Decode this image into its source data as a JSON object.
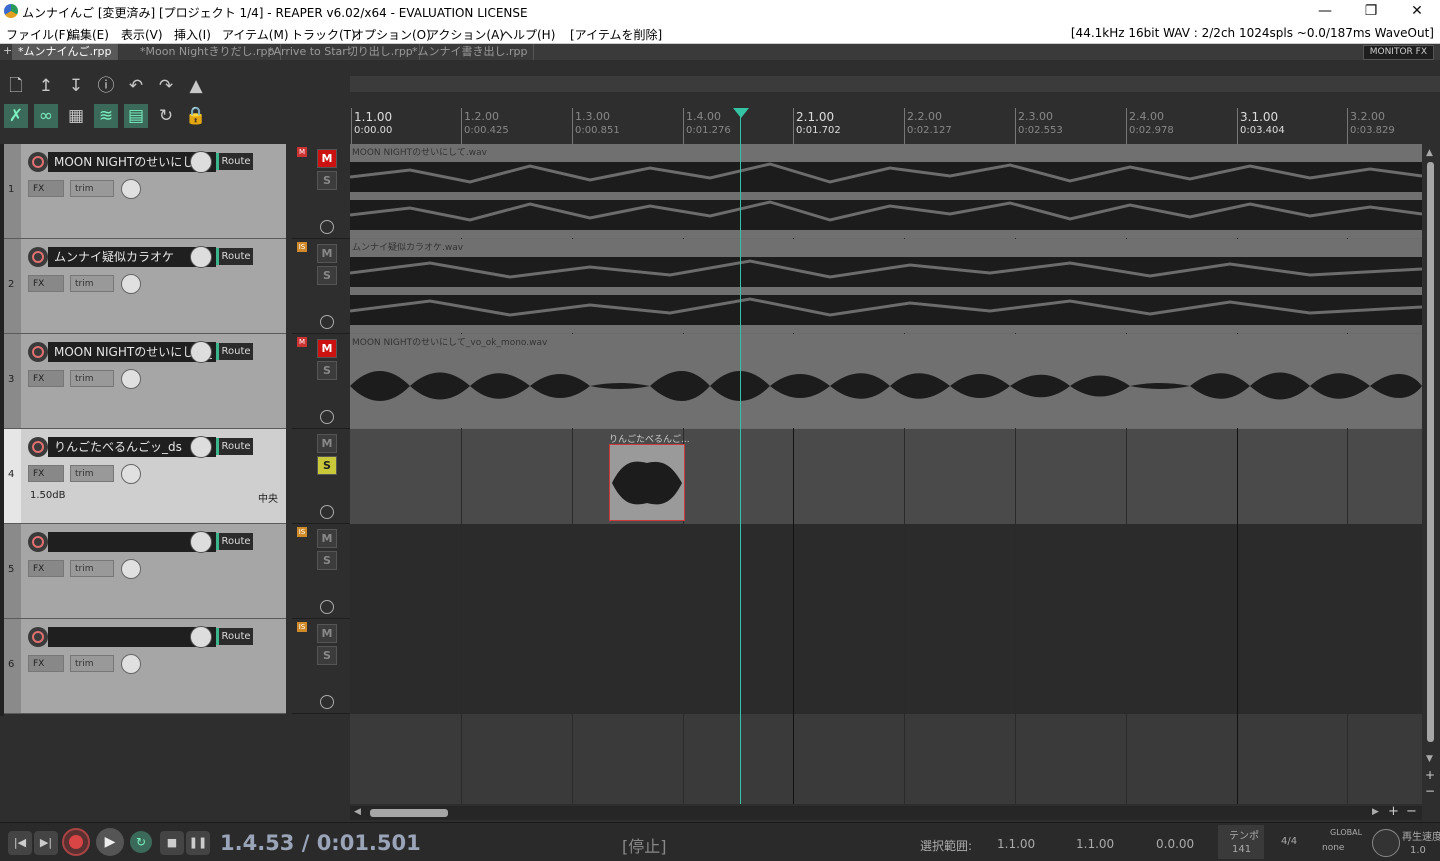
{
  "window": {
    "title": "ムンナイんご [変更済み] [プロジェクト 1/4] - REAPER v6.02/x64 - EVALUATION LICENSE"
  },
  "menu": {
    "items": [
      "ファイル(F)",
      "編集(E)",
      "表示(V)",
      "挿入(I)",
      "アイテム(M)",
      "トラック(T)",
      "オプション(O)",
      "アクション(A)",
      "ヘルプ(H)",
      "[アイテムを削除]"
    ],
    "status": "[44.1kHz 16bit WAV : 2/2ch 1024spls ~0.0/187ms WaveOut]"
  },
  "tabs": [
    {
      "label": "*ムンナイんご.rpp",
      "active": true
    },
    {
      "label": "*Moon Nightきりだし.rpp",
      "active": false
    },
    {
      "label": "*Arrive to Star切り出し.rpp",
      "active": false
    },
    {
      "label": "*ムンナイ書き出し.rpp",
      "active": false
    }
  ],
  "monitor_fx": "MONITOR FX",
  "ruler": {
    "ticks": [
      {
        "bar": "1.1.00",
        "time": "0:00.00",
        "major": true
      },
      {
        "bar": "1.2.00",
        "time": "0:00.425",
        "major": false
      },
      {
        "bar": "1.3.00",
        "time": "0:00.851",
        "major": false
      },
      {
        "bar": "1.4.00",
        "time": "0:01.276",
        "major": false
      },
      {
        "bar": "2.1.00",
        "time": "0:01.702",
        "major": true
      },
      {
        "bar": "2.2.00",
        "time": "0:02.127",
        "major": false
      },
      {
        "bar": "2.3.00",
        "time": "0:02.553",
        "major": false
      },
      {
        "bar": "2.4.00",
        "time": "0:02.978",
        "major": false
      },
      {
        "bar": "3.1.00",
        "time": "0:03.404",
        "major": true
      },
      {
        "bar": "3.2.00",
        "time": "0:03.829",
        "major": false
      }
    ]
  },
  "tracks": [
    {
      "num": "1",
      "name": "MOON NIGHTのせいにして",
      "route": "Route",
      "fx": "FX",
      "trim": "trim",
      "mute": true,
      "solo": false,
      "flag": "M",
      "item": "MOON NIGHTのせいにして.wav",
      "volume": "",
      "pan": ""
    },
    {
      "num": "2",
      "name": "ムンナイ疑似カラオケ",
      "route": "Route",
      "fx": "FX",
      "trim": "trim",
      "mute": false,
      "solo": false,
      "flag": "IS",
      "item": "ムンナイ疑似カラオケ.wav",
      "volume": "",
      "pan": ""
    },
    {
      "num": "3",
      "name": "MOON NIGHTのせいにして_",
      "route": "Route",
      "fx": "FX",
      "trim": "trim",
      "mute": true,
      "solo": false,
      "flag": "M",
      "item": "MOON NIGHTのせいにして_vo_ok_mono.wav",
      "volume": "",
      "pan": ""
    },
    {
      "num": "4",
      "name": "りんごたべるんごッ_ds",
      "route": "Route",
      "fx": "FX",
      "trim": "trim",
      "mute": false,
      "solo": true,
      "flag": "",
      "item": "りんごたべるんご...",
      "volume": "1.50dB",
      "pan": "中央"
    },
    {
      "num": "5",
      "name": "",
      "route": "Route",
      "fx": "FX",
      "trim": "trim",
      "mute": false,
      "solo": false,
      "flag": "IS",
      "item": "",
      "volume": "",
      "pan": ""
    },
    {
      "num": "6",
      "name": "",
      "route": "Route",
      "fx": "FX",
      "trim": "trim",
      "mute": false,
      "solo": false,
      "flag": "IS",
      "item": "",
      "volume": "",
      "pan": ""
    }
  ],
  "transport": {
    "time": "1.4.53 / 0:01.501",
    "state": "[停止]",
    "selection_label": "選択範囲:",
    "sel_start": "1.1.00",
    "sel_end": "1.1.00",
    "sel_len": "0.0.00",
    "tempo_label": "テンポ",
    "tempo": "141",
    "timesig": "4/4",
    "global_label": "GLOBAL",
    "global_value": "none",
    "rate_label": "再生速度",
    "rate_value": "1.0"
  },
  "colors": {
    "accent": "#34c4a4",
    "mute_on": "#cc1111",
    "solo_on": "#c8c83a"
  }
}
